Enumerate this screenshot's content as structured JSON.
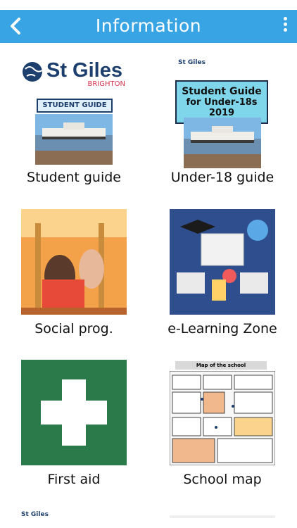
{
  "header": {
    "title": "Information",
    "back_icon": "chevron-left-icon",
    "menu_icon": "more-vertical-icon"
  },
  "tiles": [
    {
      "label": "Student guide"
    },
    {
      "label": "Under-18 guide"
    },
    {
      "label": "Social prog."
    },
    {
      "label": "e-Learning Zone"
    },
    {
      "label": "First aid"
    },
    {
      "label": "School map"
    }
  ],
  "student_guide_cover": {
    "brand": "St Giles",
    "city": "BRIGHTON",
    "badge": "STUDENT GUIDE"
  },
  "u18_cover": {
    "brand": "St Giles",
    "line1": "Student Guide",
    "line2": "for Under-18s",
    "line3": "2019"
  },
  "school_map": {
    "title": "Map of the school"
  },
  "partial_tile_text": "St Giles",
  "colors": {
    "header": "#38a4e4",
    "first_aid": "#2b7a4a",
    "elearning": "#2f4e8e"
  }
}
